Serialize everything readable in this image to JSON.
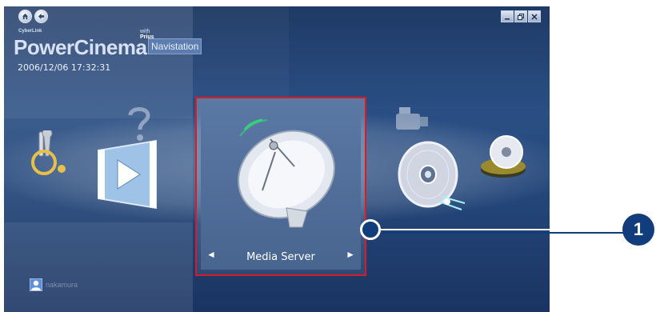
{
  "top_nav": {
    "home_icon": "home-icon",
    "back_icon": "back-arrow-icon"
  },
  "window_controls": [
    "minimize-icon",
    "restore-icon",
    "close-icon"
  ],
  "logo": {
    "small_text": "CyberLink",
    "main": "PowerCinema",
    "with": "with",
    "brand": "Prius",
    "addon": "Navistation"
  },
  "clock": "2006/12/06   17:32:31",
  "carousel": {
    "items": [
      {
        "name": "settings-tools-icon"
      },
      {
        "name": "help-icon"
      },
      {
        "name": "movie-player-icon"
      },
      {
        "name": "media-server-dish-icon",
        "selected": true
      },
      {
        "name": "camcorder-icon"
      },
      {
        "name": "dvd-disc-icon"
      },
      {
        "name": "burn-disc-icon"
      }
    ],
    "selected_label": "Media Server",
    "prev_glyph": "◄",
    "next_glyph": "►"
  },
  "user": {
    "name": "nakamura",
    "icon": "user-icon"
  },
  "callout": {
    "number": "1"
  },
  "colors": {
    "highlight_border": "#d61c26",
    "callout_blue": "#123d7c",
    "background": "#24477a"
  }
}
